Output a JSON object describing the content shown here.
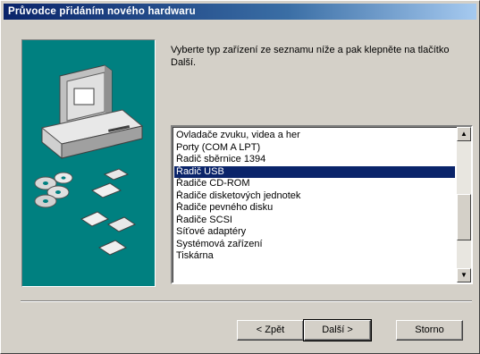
{
  "window": {
    "title": "Průvodce přidáním nového hardwaru"
  },
  "instruction": "Vyberte typ zařízení ze seznamu níže a pak klepněte na tlačítko Další.",
  "device_list": {
    "items": [
      "Ovladače zvuku, videa a her",
      "Porty (COM A LPT)",
      "Řadič sběrnice 1394",
      "Řadič USB",
      "Řadiče CD-ROM",
      "Řadiče disketových jednotek",
      "Řadiče pevného disku",
      "Řadiče SCSI",
      "Síťové adaptéry",
      "Systémová zařízení",
      "Tiskárna"
    ],
    "selected": "Řadič USB",
    "scroll_up_icon": "▲",
    "scroll_down_icon": "▼"
  },
  "buttons": {
    "back": "< Zpět",
    "next": "Další >",
    "cancel": "Storno"
  },
  "colors": {
    "titlebar_start": "#0a246a",
    "titlebar_end": "#a6caf0",
    "art_background": "#008080",
    "selection": "#0a246a"
  }
}
